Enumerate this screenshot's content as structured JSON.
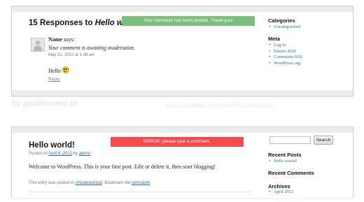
{
  "colors": {
    "success": "#79c178",
    "error": "#f44a4e",
    "link": "#2a6db5"
  },
  "top": {
    "heading_prefix": "15 Responses to ",
    "heading_title": "Hello world!",
    "notice": "Your comment has been posted. Thank you!",
    "comment": {
      "author": "Name",
      "says": "says:",
      "moderation": "Your comment is awaiting moderation.",
      "date": "May 31, 2012 at 1:48 am",
      "text": "Hello",
      "reply": "Reply"
    },
    "sidebar": {
      "categories_heading": "Categories",
      "categories": [
        "Uncategorized"
      ],
      "meta_heading": "Meta",
      "meta": [
        "Log in",
        "Entries RSS",
        "Comments RSS",
        "WordPress.org"
      ]
    }
  },
  "bottom": {
    "title": "Hello world!",
    "notice": "ERROR: please type a comment.",
    "meta_posted": "Posted on ",
    "meta_date": "April 6, 2012",
    "meta_by": " by ",
    "meta_author": "admin",
    "body": "Welcome to WordPress. This is your first post. Edit or delete it, then start blogging!",
    "footer_text": "This entry was posted in ",
    "footer_cat": "Uncategorized",
    "footer_mid": ". Bookmark the ",
    "footer_link": "permalink",
    "footer_end": ".",
    "search_button": "Search",
    "sidebar": {
      "recent_posts_heading": "Recent Posts",
      "recent_posts": [
        "Hello world!"
      ],
      "recent_comments_heading": "Recent Comments",
      "archives_heading": "Archives",
      "archives": [
        "April 2012"
      ]
    }
  }
}
